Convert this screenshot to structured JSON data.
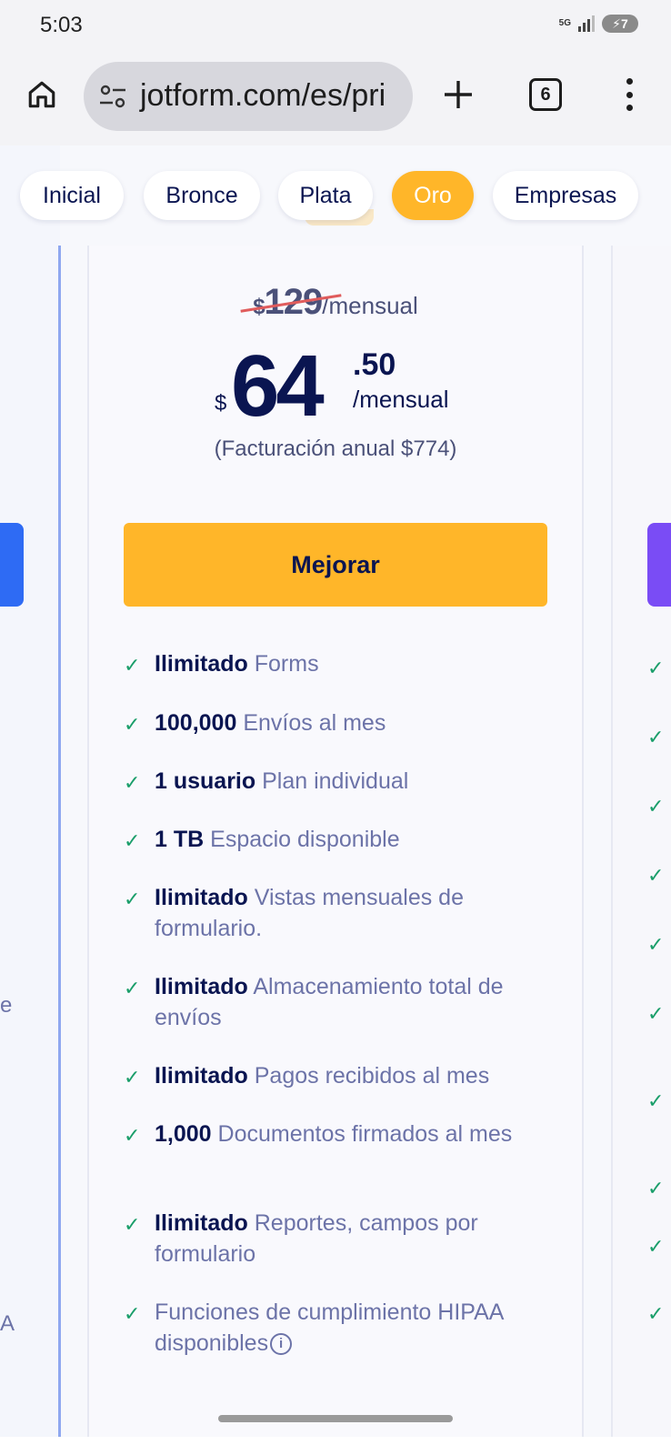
{
  "status_bar": {
    "time": "5:03",
    "network": "5G",
    "battery": "7"
  },
  "browser": {
    "url": "jotform.com/es/pri",
    "tab_count": "6"
  },
  "plan_tabs": [
    {
      "label": "Inicial",
      "active": false
    },
    {
      "label": "Bronce",
      "active": false
    },
    {
      "label": "Plata",
      "active": false
    },
    {
      "label": "Oro",
      "active": true
    },
    {
      "label": "Empresas",
      "active": false
    }
  ],
  "plan": {
    "old_price_symbol": "$",
    "old_price": "129",
    "old_price_period": "/mensual",
    "price_symbol": "$",
    "price_int": "64",
    "price_dec": ".50",
    "price_period": "/mensual",
    "billing_note": "(Facturación anual $774)",
    "cta_label": "Mejorar",
    "features": [
      {
        "bold": "Ilimitado",
        "text": "Forms"
      },
      {
        "bold": "100,000",
        "text": "Envíos al mes"
      },
      {
        "bold": "1 usuario",
        "text": "Plan individual"
      },
      {
        "bold": "1 TB",
        "text": "Espacio disponible"
      },
      {
        "bold": "Ilimitado",
        "text": "Vistas mensuales de formulario."
      },
      {
        "bold": "Ilimitado",
        "text": "Almacenamiento total de envíos"
      },
      {
        "bold": "Ilimitado",
        "text": "Pagos recibidos al mes"
      },
      {
        "bold": "1,000",
        "text": "Documentos firmados al mes"
      },
      {
        "bold": "Ilimitado",
        "text": "Reportes, campos por formulario"
      },
      {
        "bold": "",
        "text": "Funciones de cumplimiento HIPAA disponibles"
      }
    ]
  },
  "left_card_clipped_text": [
    "e",
    "A"
  ],
  "colors": {
    "accent": "#ffb629",
    "navy": "#0a1551",
    "check": "#1a9e6a",
    "muted": "#6c73a8"
  }
}
